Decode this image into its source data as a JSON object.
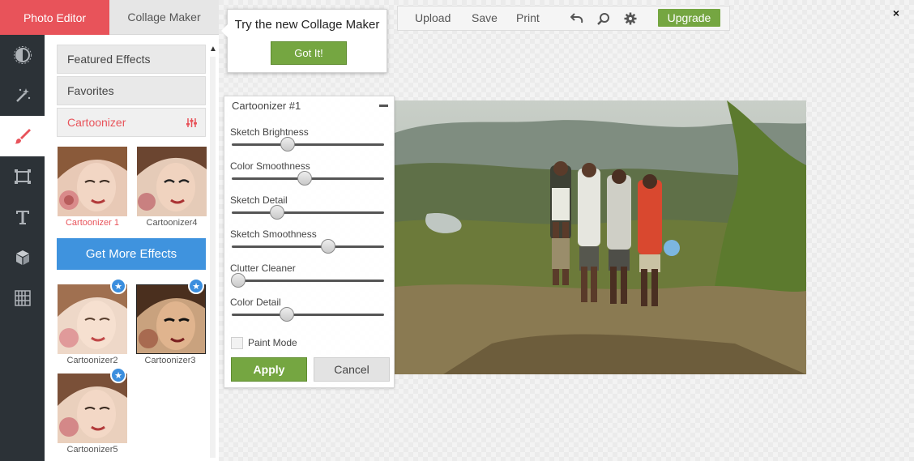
{
  "tabs": {
    "photo_editor": "Photo Editor",
    "collage_maker": "Collage Maker"
  },
  "toolbar": {
    "upload": "Upload",
    "save": "Save",
    "print": "Print",
    "upgrade": "Upgrade",
    "close": "×"
  },
  "tooltip": {
    "text": "Try the new Collage Maker",
    "button": "Got It!"
  },
  "sidebar": {
    "tools": [
      "exposure-icon",
      "magic-wand-icon",
      "brush-icon",
      "frame-icon",
      "text-icon",
      "cube-icon",
      "texture-icon"
    ],
    "active_tool": "brush-icon"
  },
  "effects": {
    "categories": {
      "featured": "Featured Effects",
      "favorites": "Favorites",
      "cartoonizer": "Cartoonizer"
    },
    "cartoonizer_thumbs": [
      {
        "label": "Cartoonizer 1",
        "selected": true
      },
      {
        "label": "Cartoonizer4",
        "selected": false
      }
    ],
    "get_more": "Get More Effects",
    "premium_thumbs": [
      {
        "label": "Cartoonizer2"
      },
      {
        "label": "Cartoonizer3"
      },
      {
        "label": "Cartoonizer5"
      }
    ],
    "star_glyph": "★"
  },
  "settings": {
    "title": "Cartoonizer #1",
    "sliders": [
      {
        "label": "Sketch Brightness",
        "value": 0.36
      },
      {
        "label": "Color Smoothness",
        "value": 0.48
      },
      {
        "label": "Sketch Detail",
        "value": 0.28
      },
      {
        "label": "Sketch Smoothness",
        "value": 0.65
      },
      {
        "label": "Clutter Cleaner",
        "value": 0.0
      },
      {
        "label": "Color Detail",
        "value": 0.35
      }
    ],
    "paint_mode": "Paint Mode",
    "apply": "Apply",
    "cancel": "Cancel"
  },
  "colors": {
    "accent": "#e8535a",
    "green": "#75a641",
    "blue": "#3f93de",
    "sidebar": "#2c3237"
  }
}
